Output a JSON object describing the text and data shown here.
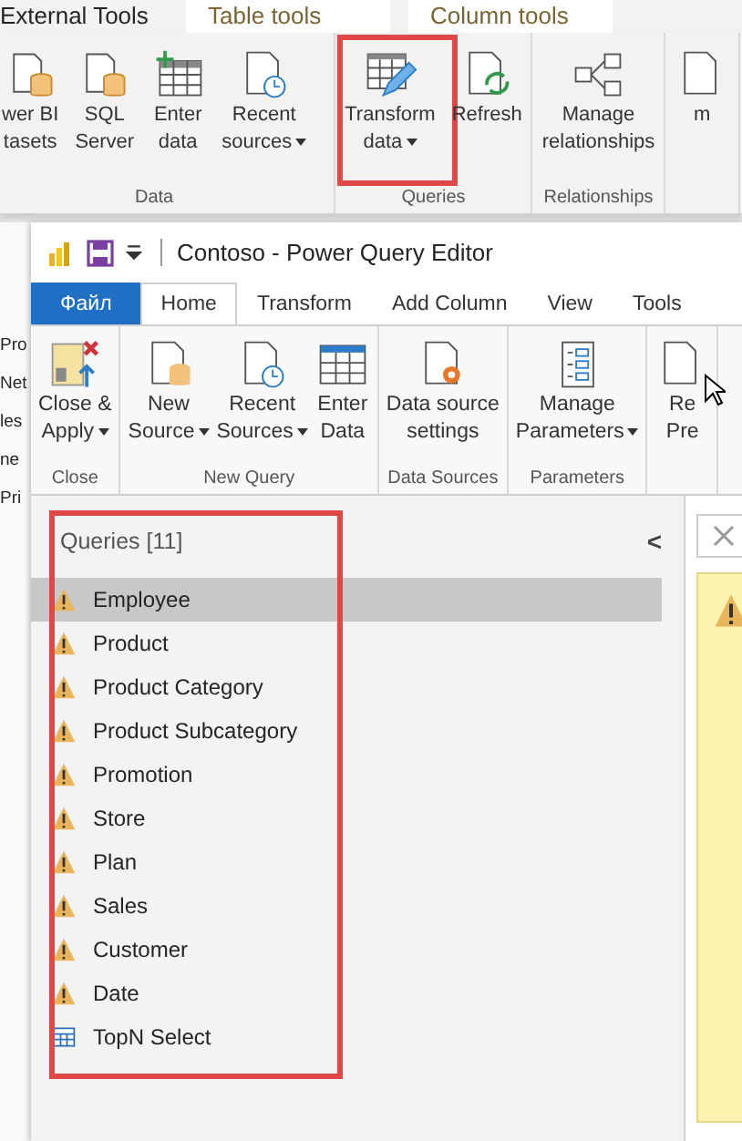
{
  "background_app": {
    "tabs": [
      {
        "label": "External Tools",
        "contextual": false
      },
      {
        "label": "Table tools",
        "contextual": true
      },
      {
        "label": "Column tools",
        "contextual": true
      }
    ],
    "ribbon_groups": [
      {
        "label": "Data",
        "buttons": [
          {
            "label": "wer BI\ntasets",
            "dropdown": false,
            "highlighted": false
          },
          {
            "label": "SQL\nServer",
            "dropdown": false,
            "highlighted": false
          },
          {
            "label": "Enter\ndata",
            "dropdown": false,
            "highlighted": false
          },
          {
            "label": "Recent\nsources",
            "dropdown": true,
            "highlighted": false
          }
        ]
      },
      {
        "label": "Queries",
        "buttons": [
          {
            "label": "Transform\ndata",
            "dropdown": true,
            "highlighted": true
          },
          {
            "label": "Refresh",
            "dropdown": false,
            "highlighted": false
          }
        ]
      },
      {
        "label": "Relationships",
        "buttons": [
          {
            "label": "Manage\nrelationships",
            "dropdown": false,
            "highlighted": false
          }
        ]
      },
      {
        "buttons": [
          {
            "label": "m",
            "dropdown": false,
            "highlighted": false
          }
        ]
      }
    ],
    "side_fragments": [
      "Pro",
      "Net",
      "les",
      "ne",
      "Pri"
    ]
  },
  "editor": {
    "title": "Contoso - Power Query Editor",
    "tabs": [
      {
        "label": "Файл",
        "kind": "file",
        "selected": false
      },
      {
        "label": "Home",
        "kind": "tab",
        "selected": true
      },
      {
        "label": "Transform",
        "kind": "tab",
        "selected": false
      },
      {
        "label": "Add Column",
        "kind": "tab",
        "selected": false
      },
      {
        "label": "View",
        "kind": "tab",
        "selected": false
      },
      {
        "label": "Tools",
        "kind": "tab",
        "selected": false
      }
    ],
    "ribbon_groups": [
      {
        "label": "Close",
        "buttons": [
          {
            "label": "Close &\nApply",
            "dropdown": true
          }
        ]
      },
      {
        "label": "New Query",
        "buttons": [
          {
            "label": "New\nSource",
            "dropdown": true
          },
          {
            "label": "Recent\nSources",
            "dropdown": true
          },
          {
            "label": "Enter\nData",
            "dropdown": false
          }
        ]
      },
      {
        "label": "Data Sources",
        "buttons": [
          {
            "label": "Data source\nsettings",
            "dropdown": false
          }
        ]
      },
      {
        "label": "Parameters",
        "buttons": [
          {
            "label": "Manage\nParameters",
            "dropdown": true
          }
        ]
      },
      {
        "buttons": [
          {
            "label": "Re\nPre",
            "dropdown": false
          }
        ]
      }
    ],
    "queries": {
      "title": "Queries [11]",
      "collapse": "<",
      "highlighted": true,
      "items": [
        {
          "name": "Employee",
          "kind": "warning",
          "selected": true
        },
        {
          "name": "Product",
          "kind": "warning",
          "selected": false
        },
        {
          "name": "Product Category",
          "kind": "warning",
          "selected": false
        },
        {
          "name": "Product Subcategory",
          "kind": "warning",
          "selected": false
        },
        {
          "name": "Promotion",
          "kind": "warning",
          "selected": false
        },
        {
          "name": "Store",
          "kind": "warning",
          "selected": false
        },
        {
          "name": "Plan",
          "kind": "warning",
          "selected": false
        },
        {
          "name": "Sales",
          "kind": "warning",
          "selected": false
        },
        {
          "name": "Customer",
          "kind": "warning",
          "selected": false
        },
        {
          "name": "Date",
          "kind": "warning",
          "selected": false
        },
        {
          "name": "TopN Select",
          "kind": "table",
          "selected": false
        }
      ]
    }
  }
}
